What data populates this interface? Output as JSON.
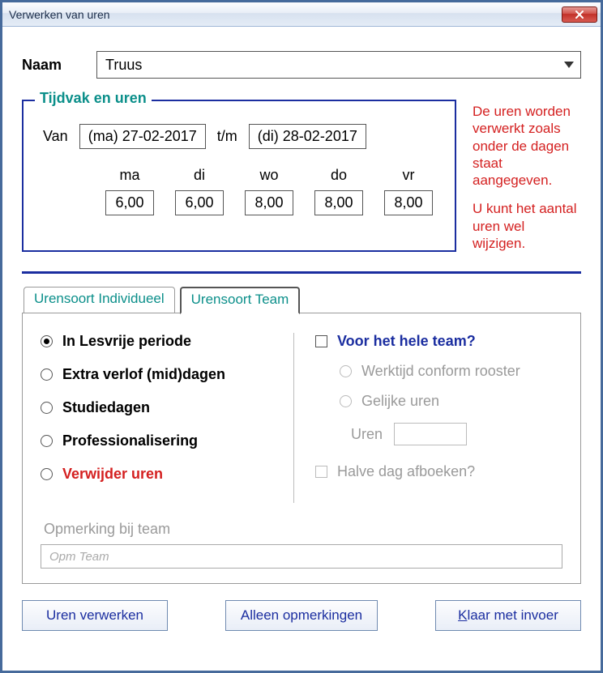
{
  "window": {
    "title": "Verwerken van uren"
  },
  "naam": {
    "label": "Naam",
    "value": "Truus"
  },
  "tijdvak": {
    "legend": "Tijdvak en uren",
    "van_label": "Van",
    "tm_label": "t/m",
    "date_from": "(ma) 27-02-2017",
    "date_to": "(di) 28-02-2017",
    "days": {
      "ma": {
        "label": "ma",
        "value": "6,00"
      },
      "di": {
        "label": "di",
        "value": "6,00"
      },
      "wo": {
        "label": "wo",
        "value": "8,00"
      },
      "do": {
        "label": "do",
        "value": "8,00"
      },
      "vr": {
        "label": "vr",
        "value": "8,00"
      }
    }
  },
  "info": {
    "line1": "De uren worden verwerkt zoals onder de dagen staat aangegeven.",
    "line2": "U kunt het aantal uren wel wijzigen."
  },
  "tabs": {
    "individueel": "Urensoort Individueel",
    "team": "Urensoort Team"
  },
  "options": {
    "lesvrij": "In Lesvrije periode",
    "extra_verlof": "Extra verlof (mid)dagen",
    "studiedagen": "Studiedagen",
    "professionalisering": "Professionalisering",
    "verwijder": "Verwijder uren"
  },
  "team": {
    "whole_team": "Voor het hele team?",
    "conform_rooster": "Werktijd conform rooster",
    "gelijke_uren": "Gelijke uren",
    "uren_label": "Uren",
    "halve_dag": "Halve dag afboeken?"
  },
  "comment": {
    "label": "Opmerking bij team",
    "placeholder": "Opm Team"
  },
  "buttons": {
    "verwerken": "Uren verwerken",
    "opmerkingen": "Alleen opmerkingen",
    "klaar_prefix": "K",
    "klaar_rest": "laar met invoer"
  }
}
